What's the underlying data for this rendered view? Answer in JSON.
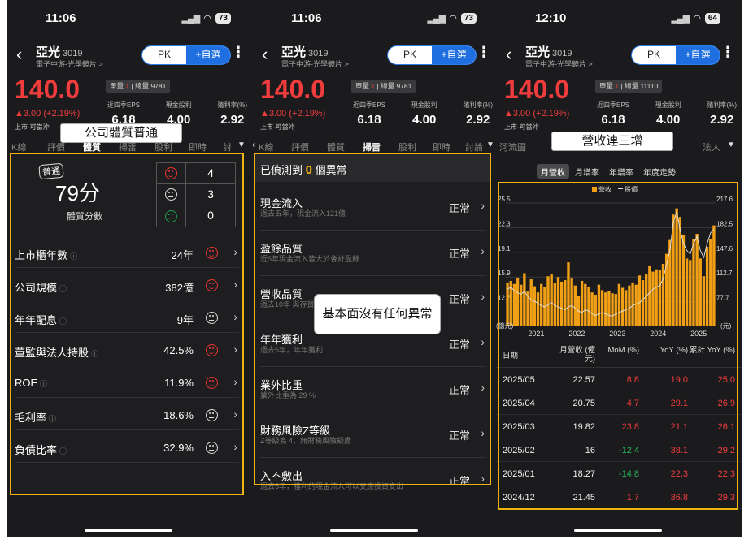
{
  "common": {
    "stock_name": "亞光",
    "stock_code": "3019",
    "industry": "電子中游-光學鏡片 >",
    "pk_label": "PK",
    "add_watch_label": "+自選",
    "price": "140.0",
    "change": "▲3.00 (+2.19%)",
    "market": "上市-可當沖",
    "vol_label_1": "單量",
    "vol_sep": "|",
    "stats": [
      {
        "label": "近四季EPS",
        "value": "6.18"
      },
      {
        "label": "現金股利",
        "value": "4.00"
      },
      {
        "label": "殖利率(%)",
        "value": "2.92"
      }
    ]
  },
  "phone1": {
    "time": "11:06",
    "battery": "73",
    "volume": "總量 9781",
    "vol_small": "1",
    "tabs": [
      "K線",
      "評價",
      "體質",
      "掃雷",
      "股利",
      "即時",
      "討"
    ],
    "callout": "公司體質普通",
    "badge": "普通",
    "score": "79分",
    "score_label": "體質分數",
    "counts": [
      "4",
      "3",
      "0"
    ],
    "metrics": [
      {
        "label": "上市櫃年數",
        "value": "24年",
        "face": "smile"
      },
      {
        "label": "公司規模",
        "value": "382億",
        "face": "smile"
      },
      {
        "label": "年年配息",
        "value": "9年",
        "face": "neutral"
      },
      {
        "label": "董監與法人持股",
        "value": "42.5%",
        "face": "smile"
      },
      {
        "label": "ROE",
        "value": "11.9%",
        "face": "smile"
      },
      {
        "label": "毛利率",
        "value": "18.6%",
        "face": "neutral"
      },
      {
        "label": "負債比率",
        "value": "32.9%",
        "face": "neutral"
      }
    ],
    "info_glyph": "ⓘ"
  },
  "phone2": {
    "time": "11:06",
    "battery": "73",
    "volume": "總量 9781",
    "vol_small": "1",
    "tabs": [
      "K線",
      "評價",
      "體質",
      "掃雷",
      "股利",
      "即時",
      "討論"
    ],
    "header_prefix": "已偵測到",
    "header_count": "0",
    "header_suffix": "個異常",
    "callout": "基本面沒有任何異常",
    "items": [
      {
        "title": "現金流入",
        "desc": "過去五年，現金流入121億",
        "status": "正常"
      },
      {
        "title": "盈餘品質",
        "desc": "近5年現金流入皆大於會計盈餘",
        "status": "正常"
      },
      {
        "title": "營收品質",
        "desc": "過去10年 與存貨佔",
        "status": "正常"
      },
      {
        "title": "年年獲利",
        "desc": "過去5年，年年獲利",
        "status": "正常"
      },
      {
        "title": "業外比重",
        "desc": "業外比重為 29 %",
        "status": "正常"
      },
      {
        "title": "財務風險Z等級",
        "desc": "Z等級為 4，無財務風險疑慮",
        "status": "正常"
      },
      {
        "title": "入不敷出",
        "desc": "過去5年，獲利的現金流入可以支應投資支出",
        "status": "正常"
      }
    ]
  },
  "phone3": {
    "time": "12:10",
    "battery": "64",
    "volume": "總量 11110",
    "vol_small": "1",
    "tabs": [
      "河流圖",
      "法人"
    ],
    "callout": "營收連三增",
    "subtabs": [
      "月營收",
      "月增率",
      "年增率",
      "年度走勢"
    ],
    "legend_bar": "營收",
    "legend_line": "股價",
    "table_headers": [
      "日期",
      "月營收 (億元)",
      "MoM (%)",
      "YoY (%)",
      "累計 YoY (%)"
    ],
    "rows": [
      {
        "date": "2025/05",
        "rev": "22.57",
        "mom": "8.8",
        "yoy": "19.0",
        "cum": "25.0"
      },
      {
        "date": "2025/04",
        "rev": "20.75",
        "mom": "4.7",
        "yoy": "29.1",
        "cum": "26.9"
      },
      {
        "date": "2025/03",
        "rev": "19.82",
        "mom": "23.8",
        "yoy": "21.1",
        "cum": "26.1"
      },
      {
        "date": "2025/02",
        "rev": "16",
        "mom": "-12.4",
        "yoy": "38.1",
        "cum": "29.2"
      },
      {
        "date": "2025/01",
        "rev": "18.27",
        "mom": "-14.8",
        "yoy": "22.3",
        "cum": "22.3"
      },
      {
        "date": "2024/12",
        "rev": "21.45",
        "mom": "1.7",
        "yoy": "36.8",
        "cum": "29.3"
      }
    ]
  },
  "chart_data": {
    "type": "bar",
    "title": "",
    "ylabel_left": "(億元)",
    "ylabel_right": "(元)",
    "ylim_left": [
      9.5,
      25.5
    ],
    "ylim_right": [
      42.3,
      217.6
    ],
    "yticks_left": [
      "25.5",
      "22.3",
      "19.1",
      "15.9",
      "12.7"
    ],
    "yticks_right": [
      "217.6",
      "182.5",
      "147.6",
      "112.7",
      "77.7"
    ],
    "xticks": [
      "2021",
      "2022",
      "2023",
      "2024",
      "2025"
    ],
    "series": [
      {
        "name": "營收",
        "values": [
          15.2,
          15.4,
          15.0,
          15.8,
          14.9,
          16.4,
          14.1,
          15.6,
          14.7,
          13.9,
          15.0,
          14.6,
          16.0,
          16.3,
          15.1,
          15.9,
          15.3,
          15.5,
          17.8,
          15.7,
          14.8,
          13.5,
          15.4,
          15.0,
          14.6,
          13.9,
          13.6,
          14.9,
          14.2,
          13.9,
          14.1,
          13.8,
          13.7,
          15.0,
          14.5,
          14.2,
          14.8,
          15.2,
          14.9,
          16.1,
          15.5,
          16.3,
          17.3,
          16.6,
          16.9,
          16.8,
          17.6,
          18.9,
          20.7,
          24.0,
          24.8,
          23.7,
          21.4,
          18.3,
          18.1,
          20.8,
          21.5,
          18.3,
          16.0,
          19.8,
          20.8,
          22.6
        ]
      },
      {
        "name": "股價",
        "values": [
          95,
          98,
          93,
          90,
          88,
          92,
          85,
          80,
          78,
          75,
          72,
          70,
          73,
          76,
          72,
          70,
          68,
          66,
          70,
          72,
          68,
          64,
          62,
          66,
          64,
          60,
          58,
          60,
          62,
          60,
          58,
          57,
          60,
          62,
          64,
          66,
          68,
          72,
          74,
          76,
          80,
          85,
          90,
          95,
          98,
          100,
          110,
          130,
          150,
          190,
          205,
          180,
          160,
          150,
          145,
          160,
          170,
          150,
          140,
          160,
          175,
          180
        ]
      }
    ]
  }
}
